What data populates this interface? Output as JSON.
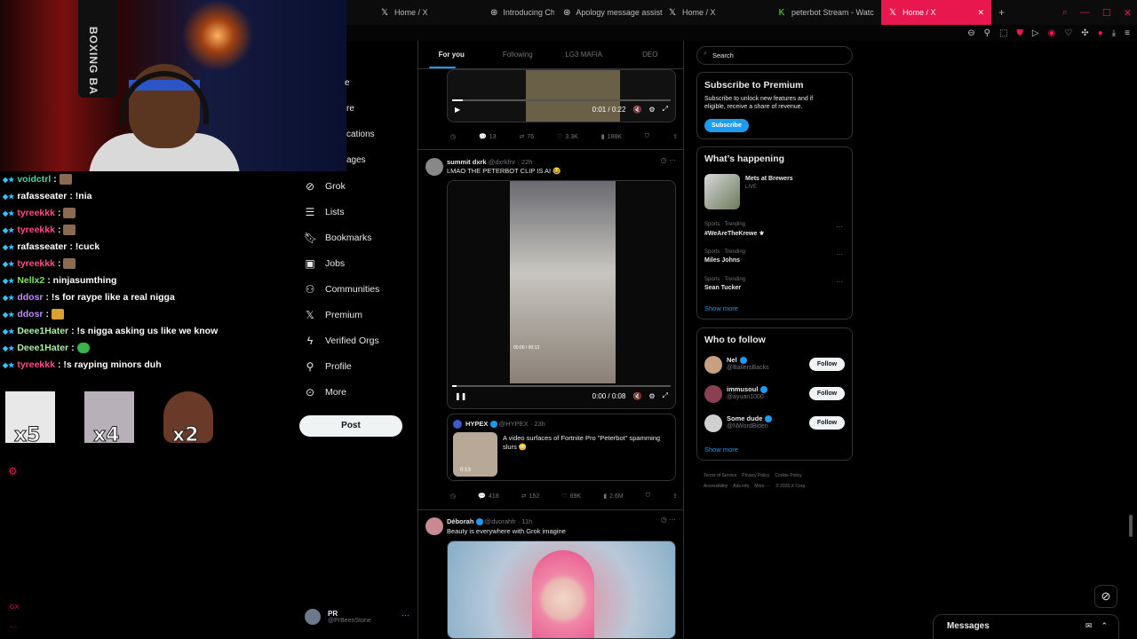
{
  "browser": {
    "tabs": [
      {
        "label": "Home / X",
        "icon": "x-logo-icon",
        "active": false
      },
      {
        "label": "Introducing ChatGPT | O",
        "icon": "chatgpt-icon",
        "active": false
      },
      {
        "label": "Apology message assist",
        "icon": "chatgpt-icon",
        "active": false
      },
      {
        "label": "Home / X",
        "icon": "x-logo-icon",
        "active": false
      },
      {
        "label": "peterbot Stream - Watc",
        "icon": "kick-icon",
        "active": false
      },
      {
        "label": "Home / X",
        "icon": "x-logo-icon",
        "active": true
      }
    ],
    "new_tab": "+",
    "accent": "#e8174d"
  },
  "webcam": {
    "bag_text": "BOXING BA"
  },
  "chat": {
    "messages": [
      {
        "user": "voidctrl",
        "text": ":",
        "user_color": "#4fd3a2",
        "emote": true
      },
      {
        "user": "rafasseater",
        "text": ": !nia",
        "user_color": "#ffffff",
        "emote": false
      },
      {
        "user": "tyreekkk",
        "text": ":",
        "user_color": "#ff4c8b",
        "emote": true
      },
      {
        "user": "tyreekkk",
        "text": ":",
        "user_color": "#ff4c8b",
        "emote": true
      },
      {
        "user": "rafasseater",
        "text": ": !cuck",
        "user_color": "#ffffff",
        "emote": false
      },
      {
        "user": "tyreekkk",
        "text": ":",
        "user_color": "#ff4c8b",
        "emote": true
      },
      {
        "user": "Nellx2",
        "text": ": ninjasumthing",
        "user_color": "#7ee06a",
        "emote": false
      },
      {
        "user": "ddosr",
        "text": ": !s for raype like a real nigga",
        "user_color": "#c08aff",
        "emote": false
      },
      {
        "user": "ddosr",
        "text": ":",
        "user_color": "#c08aff",
        "emote": true
      },
      {
        "user": "Deee1Hater",
        "text": ": !s nigga asking us like we know",
        "user_color": "#a9f0a0",
        "emote": false
      },
      {
        "user": "Deee1Hater",
        "text": ":",
        "user_color": "#a9f0a0",
        "emote": true
      },
      {
        "user": "tyreekkk",
        "text": ": !s rayping minors duh",
        "user_color": "#ff4c8b",
        "emote": false
      }
    ],
    "big_emotes": [
      {
        "count": "x5"
      },
      {
        "count": "x4"
      },
      {
        "count": "x2"
      }
    ],
    "footer_tag": "GX"
  },
  "nav": {
    "clipped": [
      {
        "label": "e"
      },
      {
        "label": "re"
      },
      {
        "label": "cations"
      },
      {
        "label": "ages"
      }
    ],
    "items": [
      {
        "label": "Grok",
        "icon": "grok-icon"
      },
      {
        "label": "Lists",
        "icon": "lists-icon"
      },
      {
        "label": "Bookmarks",
        "icon": "bookmark-icon"
      },
      {
        "label": "Jobs",
        "icon": "jobs-icon"
      },
      {
        "label": "Communities",
        "icon": "communities-icon"
      },
      {
        "label": "Premium",
        "icon": "x-logo-icon"
      },
      {
        "label": "Verified Orgs",
        "icon": "lightning-icon"
      },
      {
        "label": "Profile",
        "icon": "profile-icon"
      },
      {
        "label": "More",
        "icon": "more-circle-icon"
      }
    ],
    "post_label": "Post",
    "account": {
      "name": "PR",
      "handle": "@PrBeenStone"
    }
  },
  "feed": {
    "tabs": [
      "For you",
      "Following",
      "LG3 MAFIA",
      "DEO"
    ],
    "tweet1": {
      "video_time": "0:01 / 0:22",
      "stats": {
        "replies": "13",
        "reposts": "76",
        "likes": "3.3K",
        "views": "188K"
      }
    },
    "tweet2": {
      "name": "summit dxrk",
      "handle": "@dxrkfnr · 22h",
      "text": "LMAO THE PETERBOT CLIP IS AI 😂",
      "video_time": "0:00 / 0:08",
      "inner_time": "00:00 / 00:13",
      "quote": {
        "name": "HYPEX",
        "handle": "@HYPEX · 23h",
        "text_line1": "A video surfaces of Fortnite Pro \"Peterbot\" spamming",
        "text_line2": "slurs 😳",
        "duration": "0:13"
      },
      "stats": {
        "replies": "418",
        "reposts": "152",
        "likes": "89K",
        "views": "2.6M"
      }
    },
    "tweet3": {
      "name": "Déborah",
      "handle": "@dvorahfr · 11h",
      "text": "Beauty is everywhere with Grok imagine"
    }
  },
  "sidebar": {
    "search_placeholder": "Search",
    "premium": {
      "title": "Subscribe to Premium",
      "text_line1": "Subscribe to unlock new features and if",
      "text_line2": "eligible, receive a share of revenue.",
      "button": "Subscribe"
    },
    "happening": {
      "title": "What’s happening",
      "event": {
        "name": "Mets at Brewers",
        "status": "LIVE"
      },
      "trends": [
        {
          "meta": "Sports · Trending",
          "name": "#WeAreTheKrewe ⚜"
        },
        {
          "meta": "Sports · Trending",
          "name": "Miles Johns"
        },
        {
          "meta": "Sports · Trending",
          "name": "Sean Tucker"
        }
      ],
      "show_more": "Show more"
    },
    "who_to_follow": {
      "title": "Who to follow",
      "accounts": [
        {
          "name": "Nel",
          "handle": "@BallersBacks"
        },
        {
          "name": "immusoul",
          "handle": "@ayuan1000"
        },
        {
          "name": "Some dude",
          "handle": "@NWordBiden"
        }
      ],
      "follow_label": "Follow",
      "show_more": "Show more"
    },
    "footer": {
      "line1": [
        "Terms of Service",
        "Privacy Policy",
        "Cookie Policy"
      ],
      "line2": [
        "Accessibility",
        "Ads info",
        "More ···",
        "© 2025 X Corp."
      ]
    }
  },
  "messages": {
    "title": "Messages"
  }
}
